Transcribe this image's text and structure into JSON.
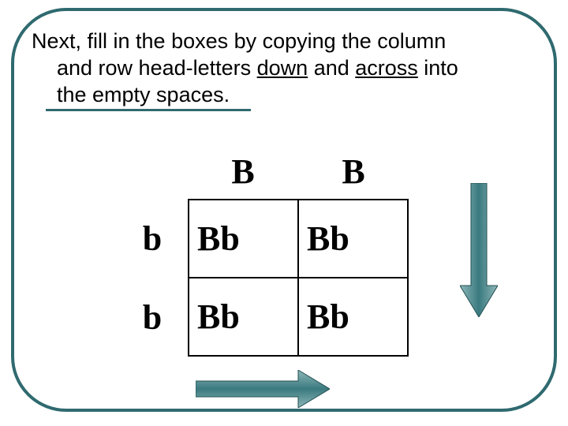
{
  "instruction": {
    "line1": "Next, fill in the boxes by copying the column",
    "line2_pre": "and row head-letters ",
    "word_down": "down",
    "line2_mid": " and ",
    "word_across": "across",
    "line2_post": " into",
    "line3": "the empty spaces."
  },
  "punnett": {
    "col_headers": [
      "B",
      "B"
    ],
    "row_headers": [
      "b",
      "b"
    ],
    "cells": [
      [
        "Bb",
        "Bb"
      ],
      [
        "Bb",
        "Bb"
      ]
    ]
  },
  "arrows": {
    "down_color": "#2f6a6f",
    "right_color": "#2f6a6f"
  }
}
